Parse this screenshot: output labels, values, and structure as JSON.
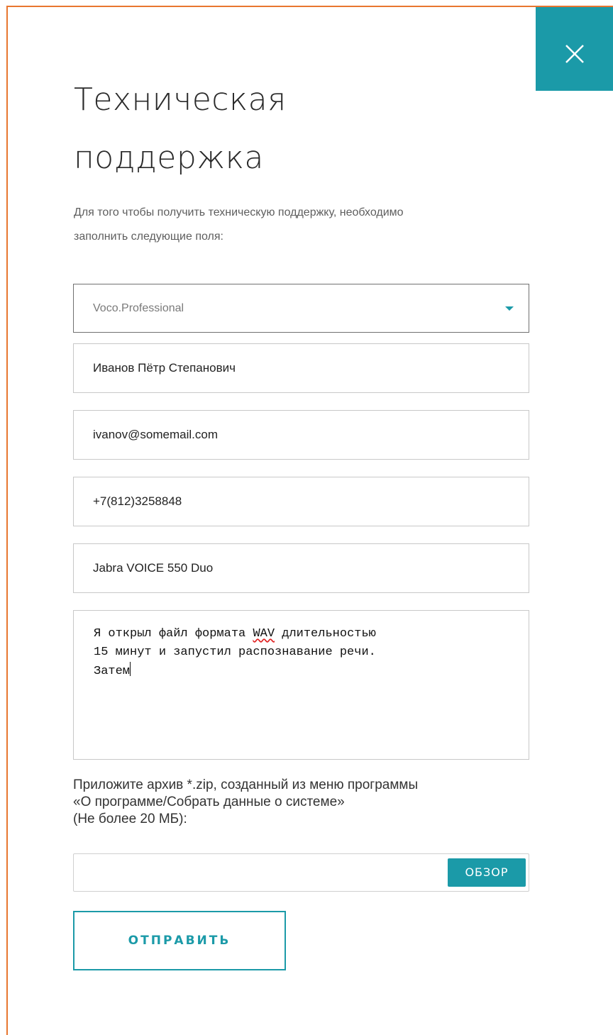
{
  "modal": {
    "title_line1": "Техническая",
    "title_line2": "поддержка",
    "intro_line1": "Для того чтобы получить техническую поддержку, необходимо",
    "intro_line2": "заполнить следующие поля:"
  },
  "form": {
    "product_select": {
      "value": "Voco.Professional"
    },
    "name_value": "Иванов Пётр Степанович",
    "email_value": "ivanov@somemail.com",
    "phone_value": "+7(812)3258848",
    "device_value": "Jabra VOICE 550 Duo",
    "message": {
      "line1_a": "Я открыл файл формата ",
      "line1_word": "WAV",
      "line1_b": " длительностью",
      "line2": "15 минут и запустил распознавание речи.",
      "line3": "Затем"
    },
    "attach_line1": "Приложите архив *.zip, созданный из меню программы",
    "attach_line2": "«О программе/Собрать данные о системе»",
    "attach_line3": "(Не более 20 МБ):",
    "browse_label": "ОБЗОР",
    "submit_label": "ОТПРАВИТЬ"
  },
  "colors": {
    "accent": "#1b9aa8",
    "frame_border": "#e8762f"
  },
  "icons": {
    "close": "close-icon",
    "select_caret": "caret-down-icon"
  }
}
